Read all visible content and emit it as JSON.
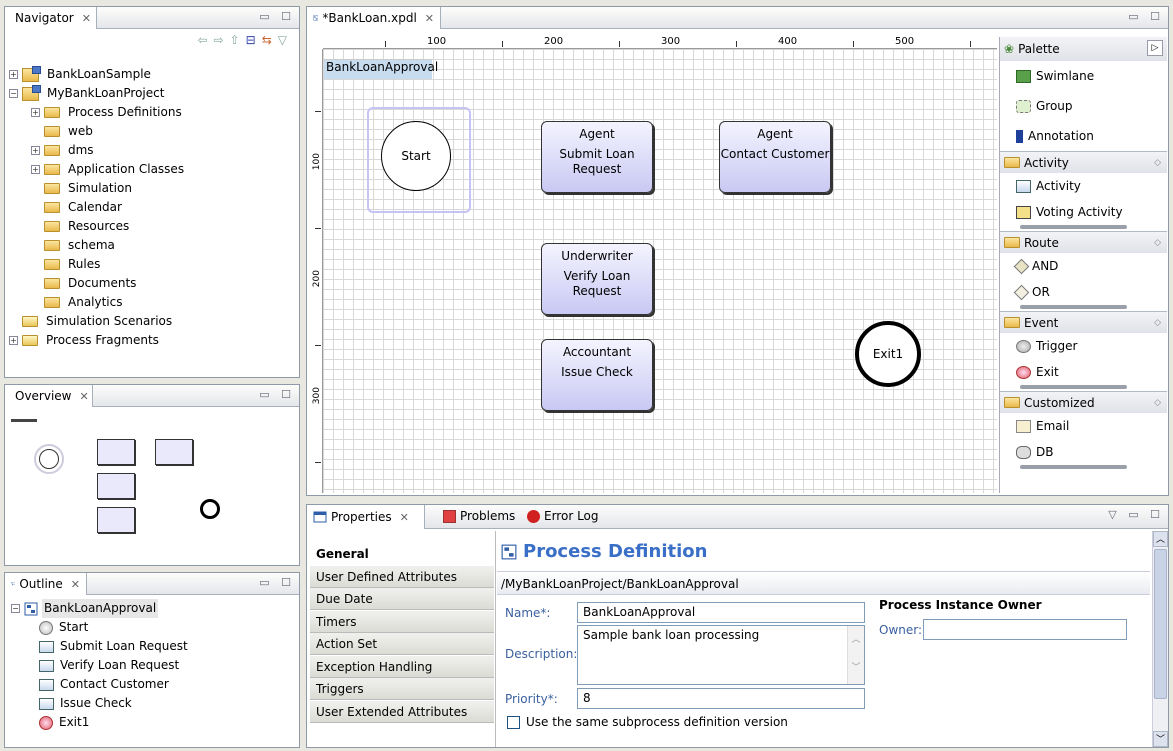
{
  "navigator": {
    "tab_label": "Navigator",
    "items": [
      {
        "label": "BankLoanSample",
        "level": 0,
        "expander": "+",
        "kind": "project"
      },
      {
        "label": "MyBankLoanProject",
        "level": 0,
        "expander": "−",
        "kind": "project"
      },
      {
        "label": "Process Definitions",
        "level": 1,
        "expander": "+",
        "kind": "folder"
      },
      {
        "label": "web",
        "level": 1,
        "expander": "",
        "kind": "folder"
      },
      {
        "label": "dms",
        "level": 1,
        "expander": "+",
        "kind": "folder"
      },
      {
        "label": "Application Classes",
        "level": 1,
        "expander": "+",
        "kind": "folder"
      },
      {
        "label": "Simulation",
        "level": 1,
        "expander": "",
        "kind": "folder"
      },
      {
        "label": "Calendar",
        "level": 1,
        "expander": "",
        "kind": "folder"
      },
      {
        "label": "Resources",
        "level": 1,
        "expander": "",
        "kind": "folder"
      },
      {
        "label": "schema",
        "level": 1,
        "expander": "",
        "kind": "folder"
      },
      {
        "label": "Rules",
        "level": 1,
        "expander": "",
        "kind": "folder"
      },
      {
        "label": "Documents",
        "level": 1,
        "expander": "",
        "kind": "folder"
      },
      {
        "label": "Analytics",
        "level": 1,
        "expander": "",
        "kind": "folder"
      },
      {
        "label": "Simulation Scenarios",
        "level": 0,
        "expander": "",
        "kind": "special"
      },
      {
        "label": "Process Fragments",
        "level": 0,
        "expander": "+",
        "kind": "special"
      }
    ]
  },
  "overview": {
    "tab_label": "Overview"
  },
  "outline": {
    "tab_label": "Outline",
    "root": "BankLoanApproval",
    "items": [
      {
        "label": "Start",
        "icon": "start-event-icon"
      },
      {
        "label": "Submit Loan Request",
        "icon": "activity-icon"
      },
      {
        "label": "Verify Loan Request",
        "icon": "activity-icon"
      },
      {
        "label": "Contact Customer",
        "icon": "activity-icon"
      },
      {
        "label": "Issue Check",
        "icon": "activity-icon"
      },
      {
        "label": "Exit1",
        "icon": "exit-event-icon"
      }
    ]
  },
  "editor": {
    "tab_label": "*BankLoan.xpdl",
    "ruler_h": [
      "100",
      "200",
      "300",
      "400",
      "500"
    ],
    "ruler_v": [
      "100",
      "200",
      "300"
    ],
    "pool_label": "BankLoanApproval",
    "start_label": "Start",
    "exit_label": "Exit1",
    "activities": [
      {
        "role": "Agent",
        "name": "Submit Loan Request"
      },
      {
        "role": "Agent",
        "name": "Contact Customer"
      },
      {
        "role": "Underwriter",
        "name": "Verify Loan Request"
      },
      {
        "role": "Accountant",
        "name": "Issue Check"
      }
    ]
  },
  "palette": {
    "title": "Palette",
    "top_items": [
      "Swimlane",
      "Group",
      "Annotation"
    ],
    "groups": [
      {
        "name": "Activity",
        "items": [
          "Activity",
          "Voting Activity"
        ]
      },
      {
        "name": "Route",
        "items": [
          "AND",
          "OR"
        ]
      },
      {
        "name": "Event",
        "items": [
          "Trigger",
          "Exit"
        ]
      },
      {
        "name": "Customized",
        "items": [
          "Email",
          "DB"
        ]
      }
    ]
  },
  "properties": {
    "tabs": [
      "Properties",
      "Problems",
      "Error Log"
    ],
    "sections": [
      "General",
      "User Defined Attributes",
      "Due Date",
      "Timers",
      "Action Set",
      "Exception Handling",
      "Triggers",
      "User Extended Attributes"
    ],
    "heading": "Process Definition",
    "path": "/MyBankLoanProject/BankLoanApproval",
    "name_label": "Name*:",
    "name_value": "BankLoanApproval",
    "description_label": "Description:",
    "description_value": "Sample bank loan processing",
    "priority_label": "Priority*:",
    "priority_value": "8",
    "checkbox_label": "Use the same subprocess definition version",
    "owner_section": "Process Instance Owner",
    "owner_label": "Owner:",
    "owner_value": ""
  },
  "colors": {
    "accent": "#3a6fc8",
    "activity_fill": "#c9c8f3",
    "selection": "#c5c4f5"
  }
}
